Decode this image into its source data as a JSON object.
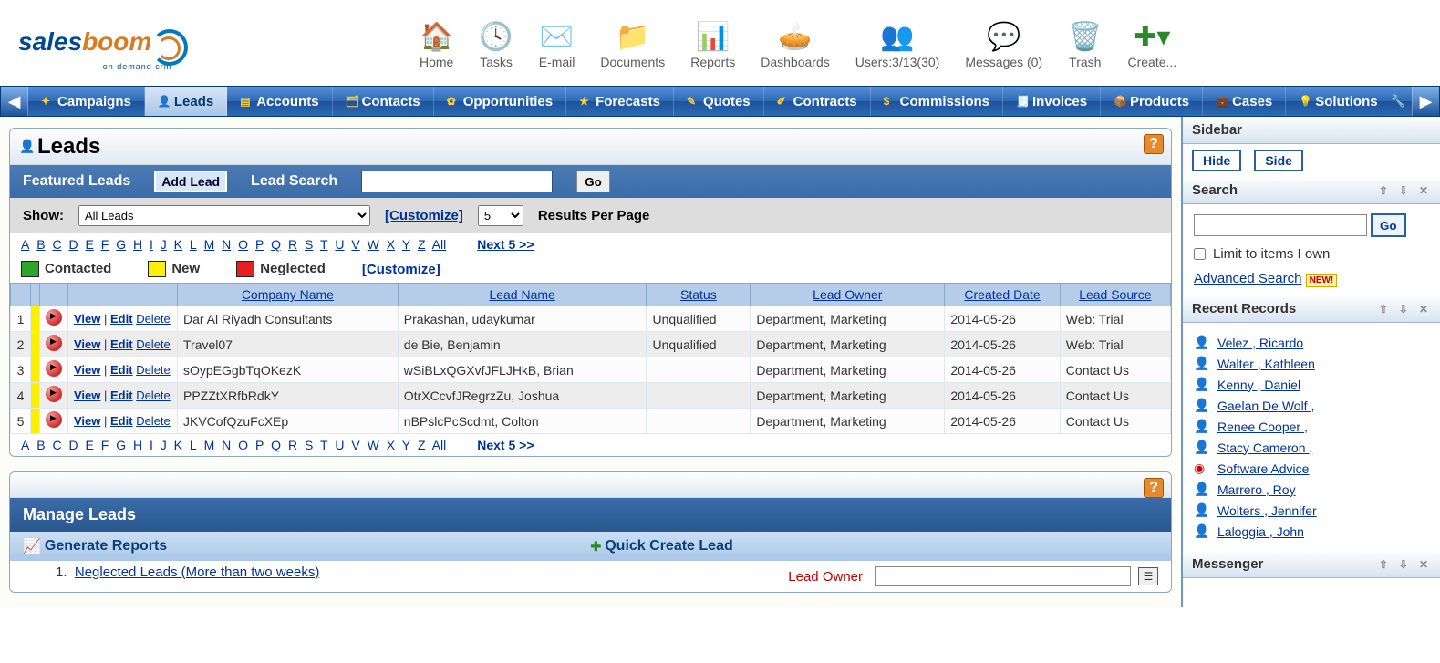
{
  "top": {
    "home": "Home",
    "tasks": "Tasks",
    "email": "E-mail",
    "documents": "Documents",
    "reports": "Reports",
    "dashboards": "Dashboards",
    "users": "Users:3/13(30)",
    "messages": "Messages (0)",
    "trash": "Trash",
    "create": "Create..."
  },
  "nav": {
    "items": [
      "Campaigns",
      "Leads",
      "Accounts",
      "Contacts",
      "Opportunities",
      "Forecasts",
      "Quotes",
      "Contracts",
      "Commissions",
      "Invoices",
      "Products",
      "Cases",
      "Solutions"
    ],
    "active": "Leads"
  },
  "leads_panel": {
    "title": "Leads",
    "featured": "Featured Leads",
    "add_btn": "Add Lead",
    "search_label": "Lead Search",
    "go": "Go",
    "show_label": "Show:",
    "show_value": "All Leads",
    "customize": "[Customize]",
    "per_page_value": "5",
    "per_page_label": "Results Per Page",
    "next": "Next 5 >>",
    "alpha": [
      "A",
      "B",
      "C",
      "D",
      "E",
      "F",
      "G",
      "H",
      "I",
      "J",
      "K",
      "L",
      "M",
      "N",
      "O",
      "P",
      "Q",
      "R",
      "S",
      "T",
      "U",
      "V",
      "W",
      "X",
      "Y",
      "Z",
      "All"
    ],
    "legend": {
      "contacted": "Contacted",
      "new": "New",
      "neglected": "Neglected",
      "customize": "[Customize]"
    },
    "columns": [
      "Company Name",
      "Lead Name",
      "Status",
      "Lead Owner",
      "Created Date",
      "Lead Source"
    ],
    "actions": {
      "view": "View",
      "edit": "Edit",
      "delete": "Delete"
    },
    "rows": [
      {
        "n": "1",
        "company": "Dar Al Riyadh Consultants",
        "lead": "Prakashan, udaykumar",
        "status": "Unqualified",
        "owner": "Department, Marketing",
        "date": "2014-05-26",
        "source": "Web: Trial"
      },
      {
        "n": "2",
        "company": "Travel07",
        "lead": "de Bie, Benjamin",
        "status": "Unqualified",
        "owner": "Department, Marketing",
        "date": "2014-05-26",
        "source": "Web: Trial"
      },
      {
        "n": "3",
        "company": "sOypEGgbTqOKezK",
        "lead": "wSiBLxQGXvfJFLJHkB, Brian",
        "status": "",
        "owner": "Department, Marketing",
        "date": "2014-05-26",
        "source": "Contact Us"
      },
      {
        "n": "4",
        "company": "PPZZtXRfbRdkY",
        "lead": "OtrXCcvfJRegrzZu, Joshua",
        "status": "",
        "owner": "Department, Marketing",
        "date": "2014-05-26",
        "source": "Contact Us"
      },
      {
        "n": "5",
        "company": "JKVCofQzuFcXEp",
        "lead": "nBPslcPcScdmt, Colton",
        "status": "",
        "owner": "Department, Marketing",
        "date": "2014-05-26",
        "source": "Contact Us"
      }
    ]
  },
  "manage_panel": {
    "title": "Manage Leads",
    "gen_reports": "Generate Reports",
    "quick_create": "Quick Create Lead",
    "report_items": [
      "Neglected Leads (More than two weeks)"
    ],
    "form": {
      "lead_owner_label": "Lead Owner"
    }
  },
  "sidebar": {
    "title": "Sidebar",
    "hide": "Hide",
    "side": "Side",
    "search": {
      "title": "Search",
      "go": "Go",
      "limit": "Limit to items I own",
      "advanced": "Advanced Search",
      "new": "NEW!"
    },
    "recent": {
      "title": "Recent Records",
      "items": [
        {
          "t": "person",
          "label": " Velez , Ricardo"
        },
        {
          "t": "person",
          "label": " Walter , Kathleen"
        },
        {
          "t": "person",
          "label": " Kenny , Daniel"
        },
        {
          "t": "person",
          "label": " Gaelan De Wolf ,"
        },
        {
          "t": "person",
          "label": " Renee Cooper ,"
        },
        {
          "t": "person",
          "label": " Stacy Cameron ,"
        },
        {
          "t": "target",
          "label": " Software Advice"
        },
        {
          "t": "person",
          "label": " Marrero , Roy"
        },
        {
          "t": "person",
          "label": " Wolters , Jennifer"
        },
        {
          "t": "person",
          "label": " Laloggia , John"
        }
      ]
    },
    "messenger": "Messenger"
  }
}
